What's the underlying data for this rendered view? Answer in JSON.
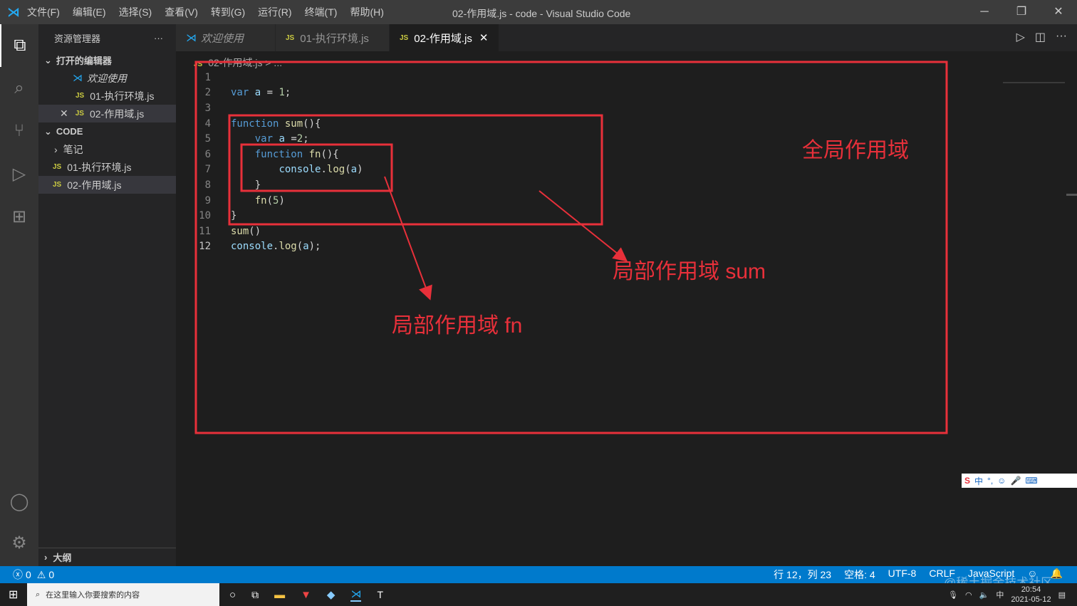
{
  "titlebar": {
    "menus": [
      "文件(F)",
      "编辑(E)",
      "选择(S)",
      "查看(V)",
      "转到(G)",
      "运行(R)",
      "终端(T)",
      "帮助(H)"
    ],
    "title": "02-作用域.js - code - Visual Studio Code"
  },
  "sidebar": {
    "title": "资源管理器",
    "open_editors": "打开的编辑器",
    "open_items": [
      "欢迎使用",
      "01-执行环境.js",
      "02-作用域.js"
    ],
    "folder": "CODE",
    "tree": [
      "笔记",
      "01-执行环境.js",
      "02-作用域.js"
    ],
    "outline": "大纲"
  },
  "tabs": [
    "欢迎使用",
    "01-执行环境.js",
    "02-作用域.js"
  ],
  "breadcrumb": "02-作用域.js > ...",
  "code": {
    "line_numbers": [
      "1",
      "2",
      "3",
      "4",
      "5",
      "6",
      "7",
      "8",
      "9",
      "10",
      "11",
      "12"
    ]
  },
  "annotations": {
    "global": "全局作用域",
    "sum": "局部作用域 sum",
    "fn": "局部作用域 fn"
  },
  "status": {
    "errors": "0",
    "warnings": "0",
    "position": "行 12，列 23",
    "spaces": "空格: 4",
    "encoding": "UTF-8",
    "eol": "CRLF",
    "language": "JavaScript"
  },
  "taskbar": {
    "search_placeholder": "在这里输入你要搜索的内容",
    "time": "20:54",
    "date": "2021-05-12",
    "ime": "中"
  },
  "watermark": "@稀土掘金技术社区"
}
